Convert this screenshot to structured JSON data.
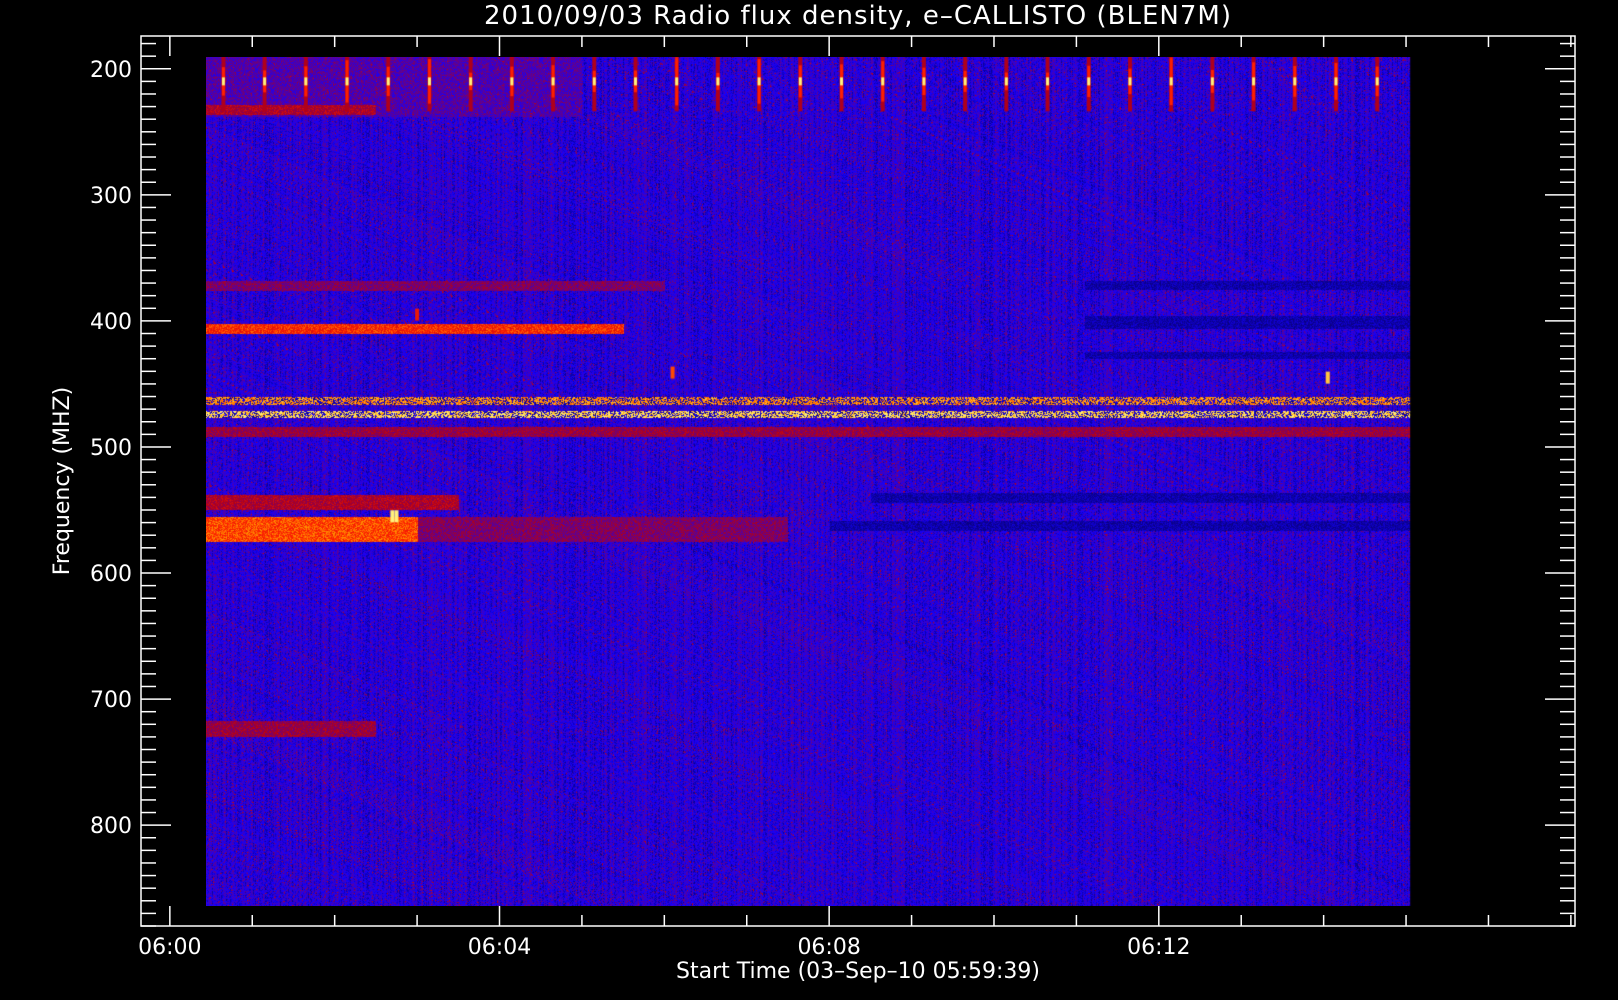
{
  "chart_data": {
    "type": "heatmap",
    "title": "2010/09/03  Radio flux density, e–CALLISTO (BLEN7M)",
    "xlabel": "Start Time (03–Sep–10 05:59:39)",
    "ylabel": "Frequency (MHZ)",
    "x_axis": {
      "unit": "minutes after 06:00 UT",
      "range": [
        -0.35,
        17.05
      ],
      "ticks": [
        {
          "value": 0,
          "label": "06:00"
        },
        {
          "value": 4,
          "label": "06:04"
        },
        {
          "value": 8,
          "label": "06:08"
        },
        {
          "value": 12,
          "label": "06:12"
        }
      ],
      "minor_step": 1
    },
    "y_axis": {
      "unit": "MHz",
      "range": [
        174,
        880
      ],
      "inverted": true,
      "ticks": [
        {
          "value": 200,
          "label": "200"
        },
        {
          "value": 300,
          "label": "300"
        },
        {
          "value": 400,
          "label": "400"
        },
        {
          "value": 500,
          "label": "500"
        },
        {
          "value": 600,
          "label": "600"
        },
        {
          "value": 700,
          "label": "700"
        },
        {
          "value": 800,
          "label": "800"
        }
      ],
      "minor_step": 10
    },
    "data_extent": {
      "t_start": 0.0,
      "t_end": 15.05,
      "f_min": 175,
      "f_max": 870
    },
    "colormap": [
      "#000000",
      "#1400ff",
      "#b0001a",
      "#ff2000",
      "#ff9a00",
      "#fff27a"
    ],
    "background_color": "#0d0bd3",
    "bands": [
      {
        "f1": 176,
        "f2": 238,
        "t1": 0.0,
        "t2": 5.0,
        "level": 0.35
      },
      {
        "f1": 228,
        "f2": 236,
        "t1": 0.0,
        "t2": 2.5,
        "level": 0.55
      },
      {
        "f1": 368,
        "f2": 376,
        "t1": 0.0,
        "t2": 6.0,
        "level": 0.45
      },
      {
        "f1": 402,
        "f2": 410,
        "t1": 0.0,
        "t2": 5.5,
        "level": 0.75
      },
      {
        "f1": 460,
        "f2": 466,
        "t1": 0.0,
        "t2": 15.05,
        "level": 0.88
      },
      {
        "f1": 471,
        "f2": 477,
        "t1": 0.0,
        "t2": 15.05,
        "level": 0.97
      },
      {
        "f1": 484,
        "f2": 492,
        "t1": 0.0,
        "t2": 15.05,
        "level": 0.5
      },
      {
        "f1": 538,
        "f2": 550,
        "t1": 0.0,
        "t2": 3.5,
        "level": 0.55
      },
      {
        "f1": 555,
        "f2": 575,
        "t1": 0.0,
        "t2": 3.0,
        "level": 0.8
      },
      {
        "f1": 555,
        "f2": 575,
        "t1": 3.0,
        "t2": 7.5,
        "level": 0.45
      },
      {
        "f1": 717,
        "f2": 730,
        "t1": 0.0,
        "t2": 2.5,
        "level": 0.5
      },
      {
        "f1": 368,
        "f2": 375,
        "t1": 11.1,
        "t2": 15.05,
        "level": 0.0
      },
      {
        "f1": 396,
        "f2": 406,
        "t1": 11.1,
        "t2": 15.05,
        "level": 0.0
      },
      {
        "f1": 424,
        "f2": 430,
        "t1": 11.1,
        "t2": 15.05,
        "level": 0.0
      },
      {
        "f1": 558,
        "f2": 566,
        "t1": 8.0,
        "t2": 15.05,
        "level": 0.05
      },
      {
        "f1": 536,
        "f2": 544,
        "t1": 8.5,
        "t2": 15.05,
        "level": 0.1
      }
    ],
    "periodic_bursts": {
      "f": 210,
      "t_start": 0.15,
      "t_end": 15.0,
      "period": 0.5,
      "level": 0.95
    },
    "spots": [
      {
        "t": 2.7,
        "f": 555,
        "level": 1.0
      },
      {
        "t": 2.75,
        "f": 555,
        "level": 1.0
      },
      {
        "t": 14.05,
        "f": 445,
        "level": 0.95
      },
      {
        "t": 6.1,
        "f": 441,
        "level": 0.8
      },
      {
        "t": 3.0,
        "f": 395,
        "level": 0.7
      }
    ]
  }
}
